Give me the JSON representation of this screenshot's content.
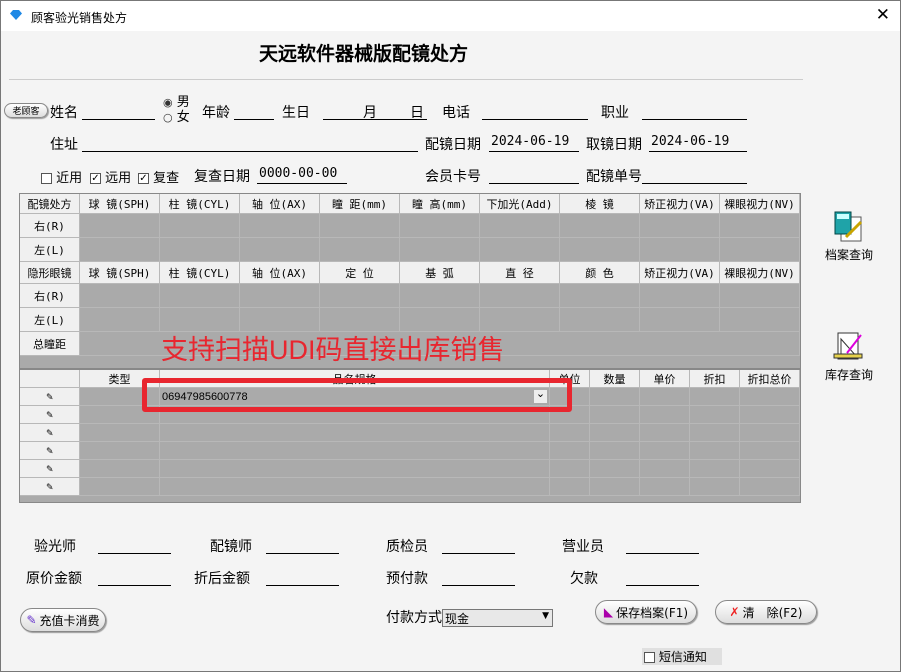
{
  "window": {
    "title": "顾客验光销售处方",
    "close": "✕"
  },
  "heading": "天远软件器械版配镜处方",
  "customer": {
    "old_customer": "老顾客",
    "name_label": "姓名",
    "name": "",
    "male": "男",
    "female": "女",
    "gender": "男",
    "age_label": "年龄",
    "birth_label": "生日",
    "month": "月",
    "day": "日",
    "phone_label": "电话",
    "job_label": "职业",
    "address_label": "住址",
    "fit_date_label": "配镜日期",
    "fit_date": "2024-06-19",
    "pickup_label": "取镜日期",
    "pickup_date": "2024-06-19",
    "near": "近用",
    "far": "远用",
    "recheck": "复查",
    "near_checked": false,
    "far_checked": true,
    "recheck_checked": true,
    "recheck_date_label": "复查日期",
    "recheck_date": "0000-00-00",
    "member_label": "会员卡号",
    "order_label": "配镜单号"
  },
  "rx": {
    "headers": [
      "配镜处方",
      "球 镜(SPH)",
      "柱 镜(CYL)",
      "轴 位(AX)",
      "瞳 距(mm)",
      "瞳 高(mm)",
      "下加光(Add)",
      "棱 镜",
      "矫正视力(VA)",
      "裸眼视力(NV)"
    ],
    "rows": [
      "右(R)",
      "左(L)"
    ],
    "contact_headers": [
      "隐形眼镜",
      "球 镜(SPH)",
      "柱 镜(CYL)",
      "轴 位(AX)",
      "定 位",
      "基 弧",
      "直 径",
      "颜 色",
      "矫正视力(VA)",
      "裸眼视力(NV)"
    ],
    "contact_rows": [
      "右(R)",
      "左(L)"
    ],
    "pd_label": "总瞳距"
  },
  "items": {
    "headers": [
      "",
      "类型",
      "品名规格",
      "单位",
      "数量",
      "单价",
      "折扣",
      "折扣总价"
    ],
    "first_value": "06947985600778",
    "row_count": 6
  },
  "annotation": "支持扫描UDI码直接出库销售",
  "side": {
    "records": "档案查询",
    "stock": "库存查询"
  },
  "staff": {
    "optometrist": "验光师",
    "fitter": "配镜师",
    "inspector": "质检员",
    "sales": "营业员",
    "orig_amount": "原价金额",
    "disc_amount": "折后金额",
    "prepaid": "预付款",
    "owed": "欠款"
  },
  "footer": {
    "card": "充值卡消费",
    "pay_label": "付款方式",
    "pay": "现金",
    "save": "保存档案(F1)",
    "clear": "清　除(F2)",
    "sms": "短信通知"
  }
}
